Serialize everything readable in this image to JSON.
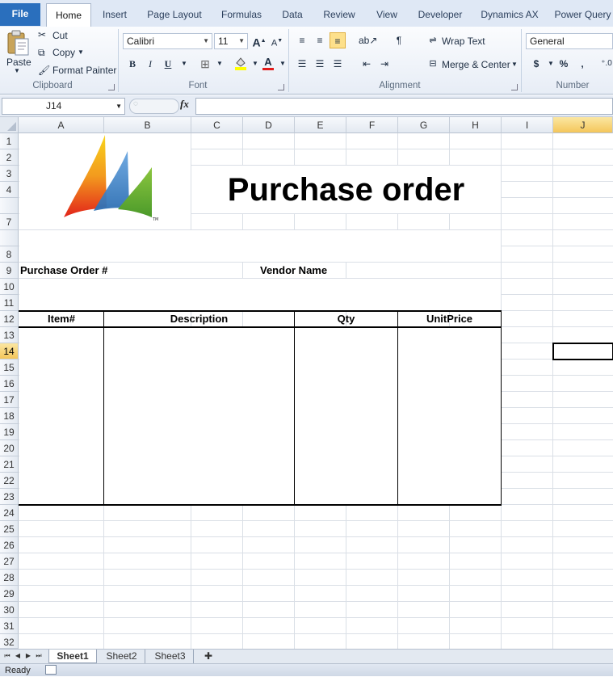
{
  "ribbon_tabs": {
    "file": "File",
    "home": "Home",
    "insert": "Insert",
    "page_layout": "Page Layout",
    "formulas": "Formulas",
    "data": "Data",
    "review": "Review",
    "view": "View",
    "developer": "Developer",
    "dynamics_ax": "Dynamics AX",
    "power_query": "Power Query"
  },
  "clipboard": {
    "paste": "Paste",
    "cut": "Cut",
    "copy": "Copy",
    "format_painter": "Format Painter",
    "label": "Clipboard"
  },
  "font": {
    "name": "Calibri",
    "size": "11",
    "label": "Font",
    "bold": "B",
    "italic": "I",
    "underline": "U",
    "color_a": "A"
  },
  "alignment": {
    "wrap_text": "Wrap Text",
    "merge_center": "Merge & Center",
    "label": "Alignment"
  },
  "number": {
    "format": "General",
    "label": "Number",
    "currency": "$",
    "percent": "%",
    "comma": ","
  },
  "formula_bar": {
    "name_box": "J14",
    "fx": "fx",
    "value": ""
  },
  "grid": {
    "columns": [
      "A",
      "B",
      "C",
      "D",
      "E",
      "F",
      "G",
      "H",
      "I",
      "J"
    ],
    "rows": [
      "1",
      "2",
      "3",
      "4",
      "",
      "7",
      "8",
      "9",
      "10",
      "11",
      "12",
      "13",
      "14",
      "15",
      "16",
      "17",
      "18",
      "19",
      "20",
      "21",
      "22",
      "23",
      "24",
      "25",
      "26",
      "27",
      "28",
      "29",
      "30",
      "31",
      "32"
    ],
    "selected_column": "J",
    "selected_row": "14"
  },
  "sheet": {
    "title": "Purchase order",
    "po_label": "Purchase Order #",
    "vendor_label": "Vendor Name",
    "table_headers": [
      "Item#",
      "Description",
      "Qty",
      "UnitPrice"
    ]
  },
  "sheet_tabs": [
    "Sheet1",
    "Sheet2",
    "Sheet3"
  ],
  "status": {
    "text": "Ready"
  },
  "colors": {
    "accent": "#2a6fbd",
    "selection": "#f4c65a"
  }
}
